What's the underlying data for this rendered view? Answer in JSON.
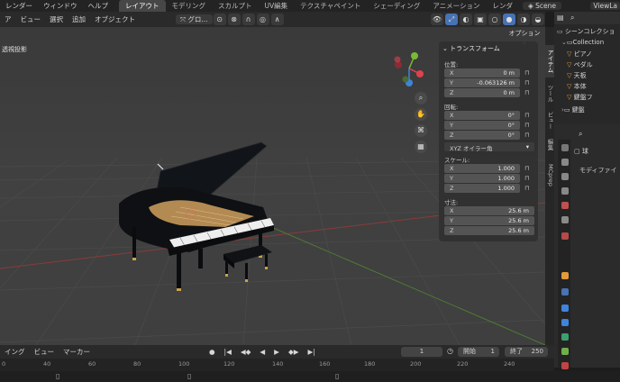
{
  "menubar": {
    "items": [
      "レンダー",
      "ウィンドウ",
      "ヘルプ"
    ],
    "tabs": [
      {
        "label": "レイアウト",
        "active": true
      },
      {
        "label": "モデリング"
      },
      {
        "label": "スカルプト"
      },
      {
        "label": "UV編集"
      },
      {
        "label": "テクスチャペイント"
      },
      {
        "label": "シェーディング"
      },
      {
        "label": "アニメーション"
      },
      {
        "label": "レンダ"
      }
    ],
    "scene": "Scene",
    "view_layer": "ViewLa"
  },
  "viewport_header": {
    "mode_label": "ア",
    "view": "ビュー",
    "select": "選択",
    "add": "追加",
    "object": "オブジェクト",
    "orientation": "グロ...",
    "options": "オプション"
  },
  "viewport": {
    "overlay_text": "透視投影"
  },
  "npanel": {
    "title": "トランスフォーム",
    "location_label": "位置:",
    "location": [
      {
        "axis": "X",
        "value": "0 m"
      },
      {
        "axis": "Y",
        "value": "-0.063126 m"
      },
      {
        "axis": "Z",
        "value": "0 m"
      }
    ],
    "rotation_label": "回転:",
    "rotation": [
      {
        "axis": "X",
        "value": "0°"
      },
      {
        "axis": "Y",
        "value": "0°"
      },
      {
        "axis": "Z",
        "value": "0°"
      }
    ],
    "rotation_mode": "XYZ オイラー角",
    "scale_label": "スケール:",
    "scale": [
      {
        "axis": "X",
        "value": "1.000"
      },
      {
        "axis": "Y",
        "value": "1.000"
      },
      {
        "axis": "Z",
        "value": "1.000"
      }
    ],
    "dimensions_label": "寸法:",
    "dimensions": [
      {
        "axis": "X",
        "value": "25.6 m"
      },
      {
        "axis": "Y",
        "value": "25.6 m"
      },
      {
        "axis": "Z",
        "value": "25.6 m"
      }
    ]
  },
  "sidetabs": [
    "アイテム",
    "ツール",
    "ビュー",
    "編集",
    "MCprep"
  ],
  "outliner": {
    "collection": "シーンコレクショ",
    "items": [
      "Collection",
      "ピアノ",
      "ペダル",
      "天板",
      "本体",
      "鍵盤フ",
      "鍵盤"
    ]
  },
  "properties": {
    "object_name": "球",
    "modifier_label": "モディファイ"
  },
  "timeline": {
    "playback": "イング",
    "view": "ビュー",
    "marker": "マーカー",
    "current_frame": "1",
    "start_label": "開始",
    "start": "1",
    "end_label": "終了",
    "end": "250",
    "ticks": [
      "0",
      "40",
      "60",
      "80",
      "100",
      "120",
      "140",
      "160",
      "180",
      "200",
      "220",
      "240"
    ]
  },
  "colors": {
    "accent": "#4772b3",
    "axis_x": "#e0404f",
    "axis_y": "#7ab935",
    "axis_z": "#3e84dc"
  }
}
